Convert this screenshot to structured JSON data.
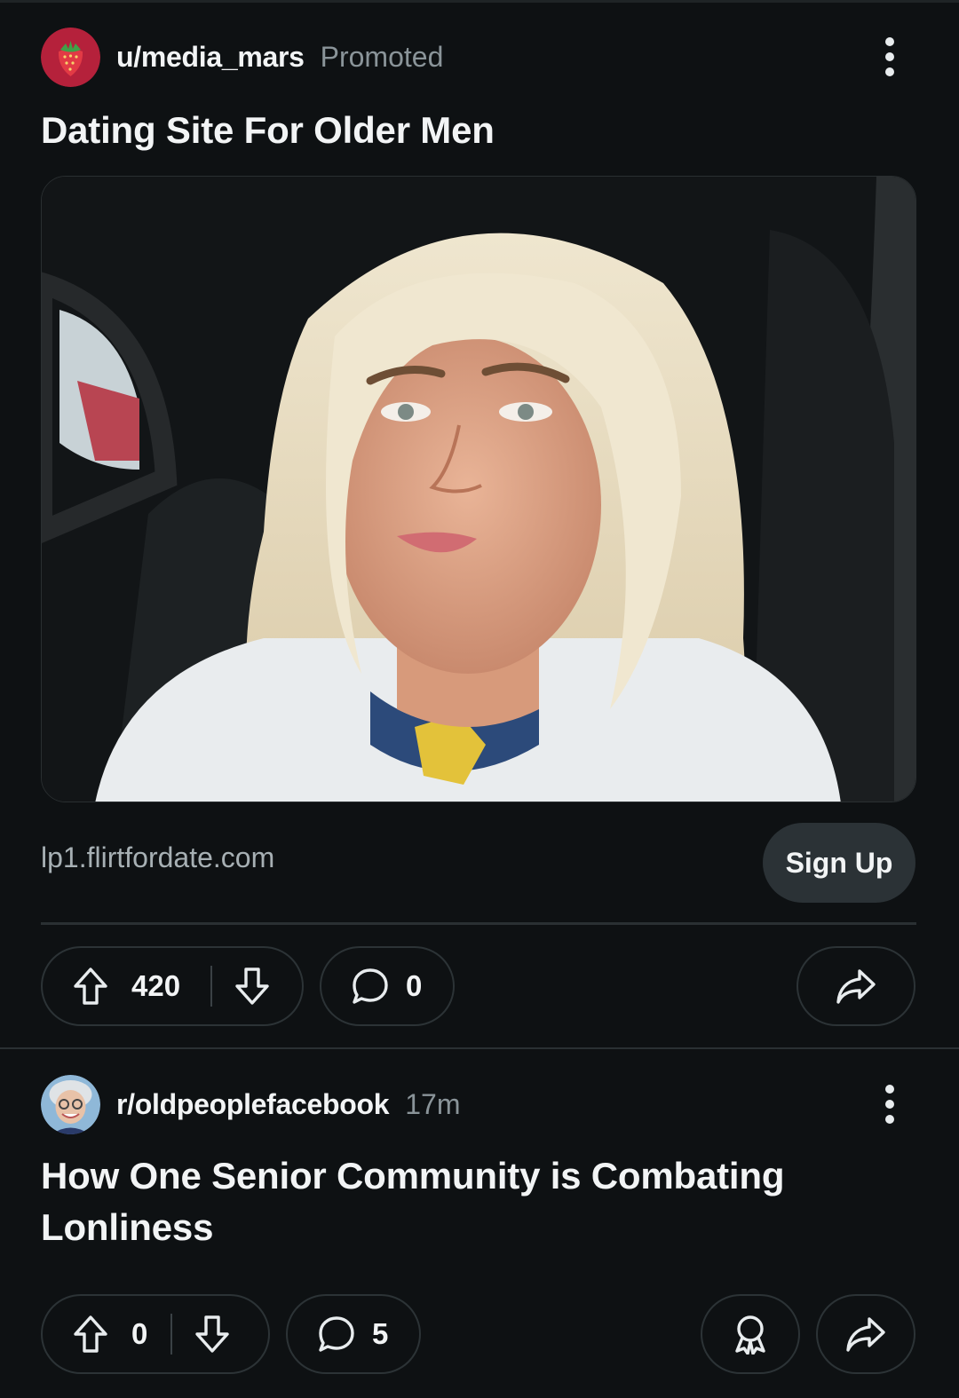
{
  "posts": [
    {
      "author": "u/media_mars",
      "meta": "Promoted",
      "title": "Dating Site For Older Men",
      "link_domain": "lp1.flirtfordate.com",
      "cta_label": "Sign Up",
      "upvotes": "420",
      "comments": "0"
    },
    {
      "author": "r/oldpeoplefacebook",
      "meta": "17m",
      "title_line1": "How One Senior Community is Combating",
      "title_line2": "Lonliness",
      "upvotes": "0",
      "comments": "5"
    }
  ],
  "icons": [
    "strawberry-avatar-icon",
    "more-options-icon",
    "upvote-icon",
    "downvote-icon",
    "comment-icon",
    "share-icon",
    "award-icon",
    "elderly-avatar-icon"
  ],
  "colors": {
    "background": "#0e1113",
    "pill_border": "#2c3336",
    "signup_bg": "#2b3236",
    "muted_text": "#8a9499"
  }
}
